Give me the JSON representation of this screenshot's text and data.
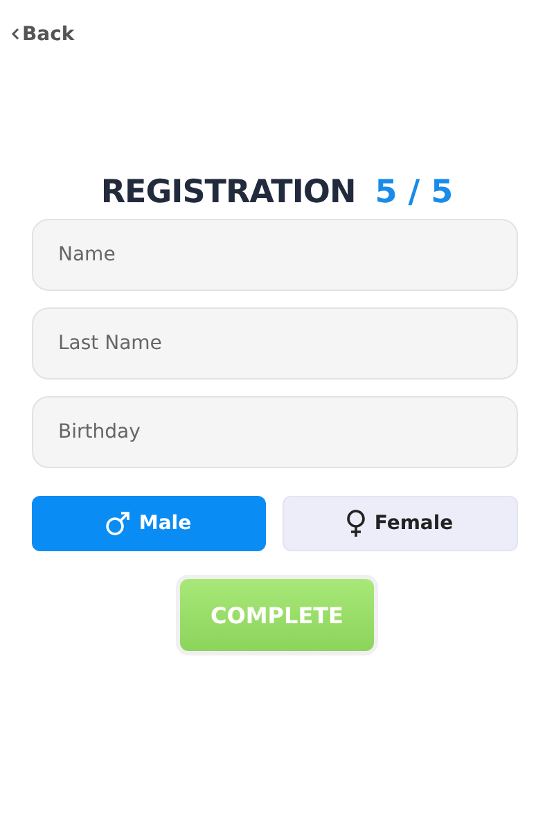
{
  "back": {
    "label": "Back"
  },
  "title": "REGISTRATION",
  "step": "5 / 5",
  "fields": [
    {
      "placeholder": "Name"
    },
    {
      "placeholder": "Last Name"
    },
    {
      "placeholder": "Birthday"
    }
  ],
  "gender": [
    {
      "kind": "male",
      "label": "Male",
      "selected": true
    },
    {
      "kind": "female",
      "label": "Female",
      "selected": false
    }
  ],
  "submit": {
    "label": "COMPLETE"
  }
}
